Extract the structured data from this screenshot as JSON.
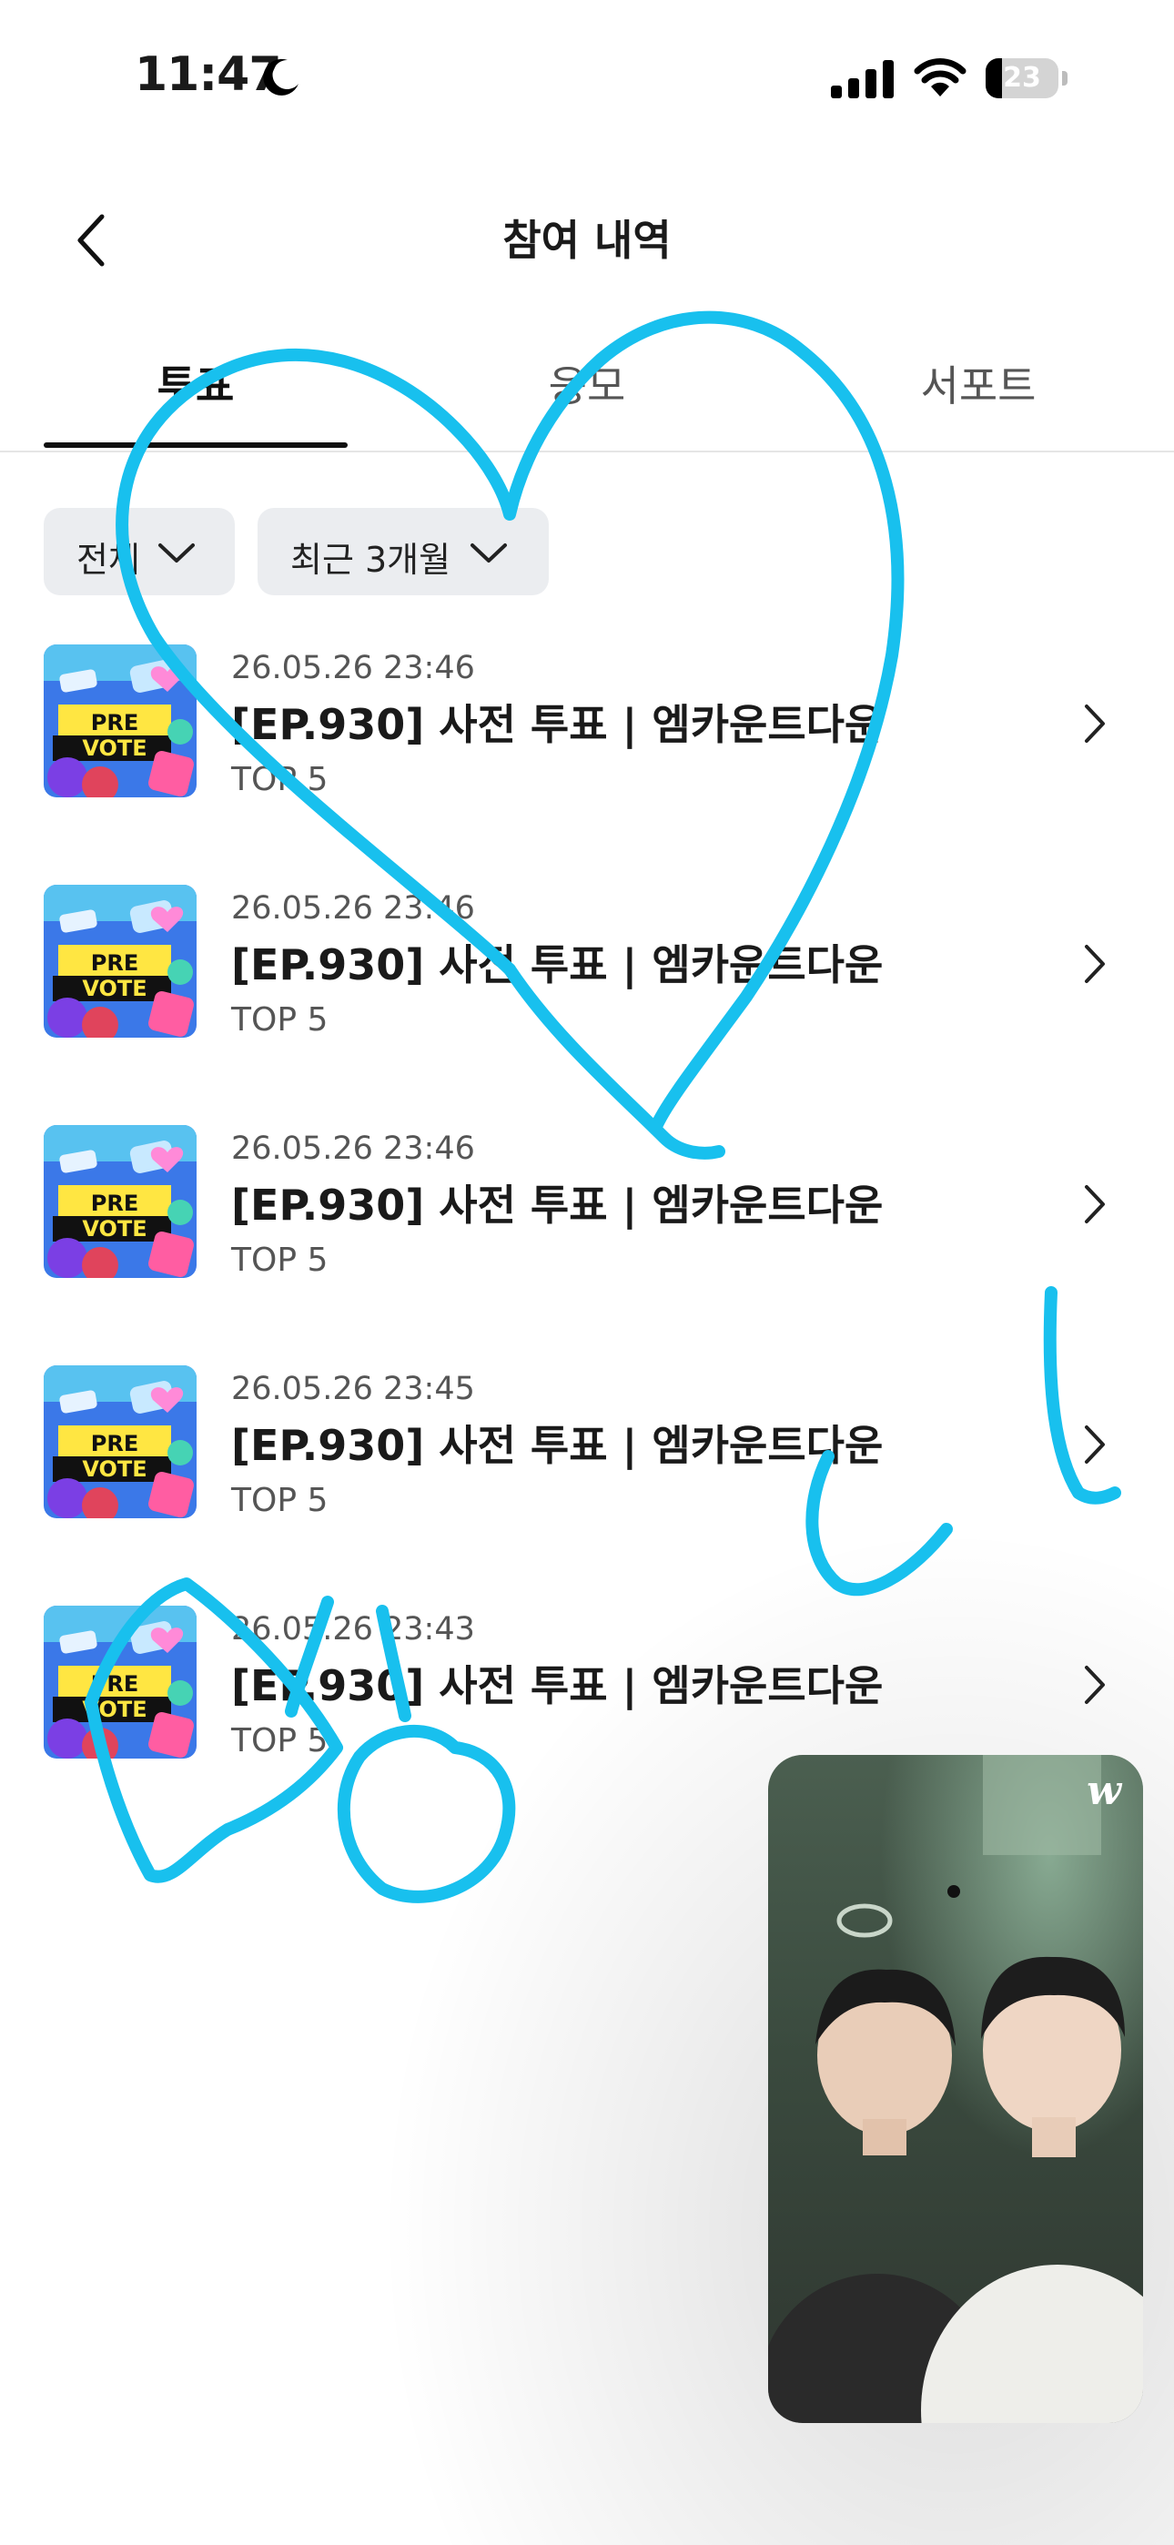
{
  "status_bar": {
    "time": "11:47",
    "battery": "23",
    "battery_level": 0.23
  },
  "header": {
    "title": "참여 내역",
    "back": "back"
  },
  "tabs": [
    {
      "label": "투표",
      "active": true
    },
    {
      "label": "응모",
      "active": false
    },
    {
      "label": "서포트",
      "active": false
    }
  ],
  "filters": [
    {
      "label": "전체"
    },
    {
      "label": "최근 3개월"
    }
  ],
  "thumbnail": {
    "line1": "PRE",
    "line2": "VOTE"
  },
  "items": [
    {
      "date": "26.05.26 23:46",
      "title": "[EP.930] 사전 투표 | 엠카운트다운",
      "sub": "TOP 5"
    },
    {
      "date": "26.05.26 23:46",
      "title": "[EP.930] 사전 투표 | 엠카운트다운",
      "sub": "TOP 5"
    },
    {
      "date": "26.05.26 23:46",
      "title": "[EP.930] 사전 투표 | 엠카운트다운",
      "sub": "TOP 5"
    },
    {
      "date": "26.05.26 23:45",
      "title": "[EP.930] 사전 투표 | 엠카운트다운",
      "sub": "TOP 5"
    },
    {
      "date": "26.05.26 23:43",
      "title": "[EP.930] 사전 투표 | 엠카운트다운",
      "sub": "TOP 5"
    }
  ],
  "video": {
    "brand": "w"
  },
  "colors": {
    "doodle": "#18c0ee",
    "tab_active": "#111111",
    "filter_bg": "#ebedf0"
  }
}
